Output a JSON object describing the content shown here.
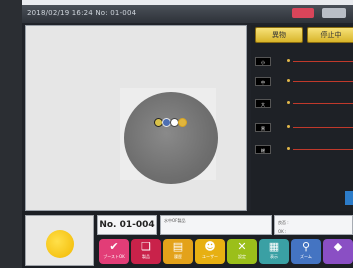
{
  "status_bar": {
    "timestamp": "2018/02/19  16:24  No: 01-004"
  },
  "controls": {
    "start_label": "異物",
    "stop_label": "停止中"
  },
  "meters": [
    {
      "label": "小"
    },
    {
      "label": "中"
    },
    {
      "label": "大"
    },
    {
      "label": "黒"
    },
    {
      "label": "総"
    }
  ],
  "info": {
    "lot_number": "No. 01-004",
    "sample_name": "水中OF製品",
    "result_label": "良否 :",
    "ok_label": "OK :"
  },
  "colors": {
    "accent_gold": "#d8b52a",
    "status_red": "#d9455a",
    "meter_line": "#c0392b"
  },
  "toolbar": {
    "tools": [
      {
        "icon": "ok-icon",
        "label": "ブーストOK"
      },
      {
        "icon": "book-icon",
        "label": "製品"
      },
      {
        "icon": "chart-icon",
        "label": "履歴"
      },
      {
        "icon": "people-icon",
        "label": "ユーザー"
      },
      {
        "icon": "wrench-icon",
        "label": "設定"
      },
      {
        "icon": "layers-icon",
        "label": "表示"
      },
      {
        "icon": "search-icon",
        "label": "ズーム"
      },
      {
        "icon": "extra-icon",
        "label": ""
      }
    ]
  }
}
